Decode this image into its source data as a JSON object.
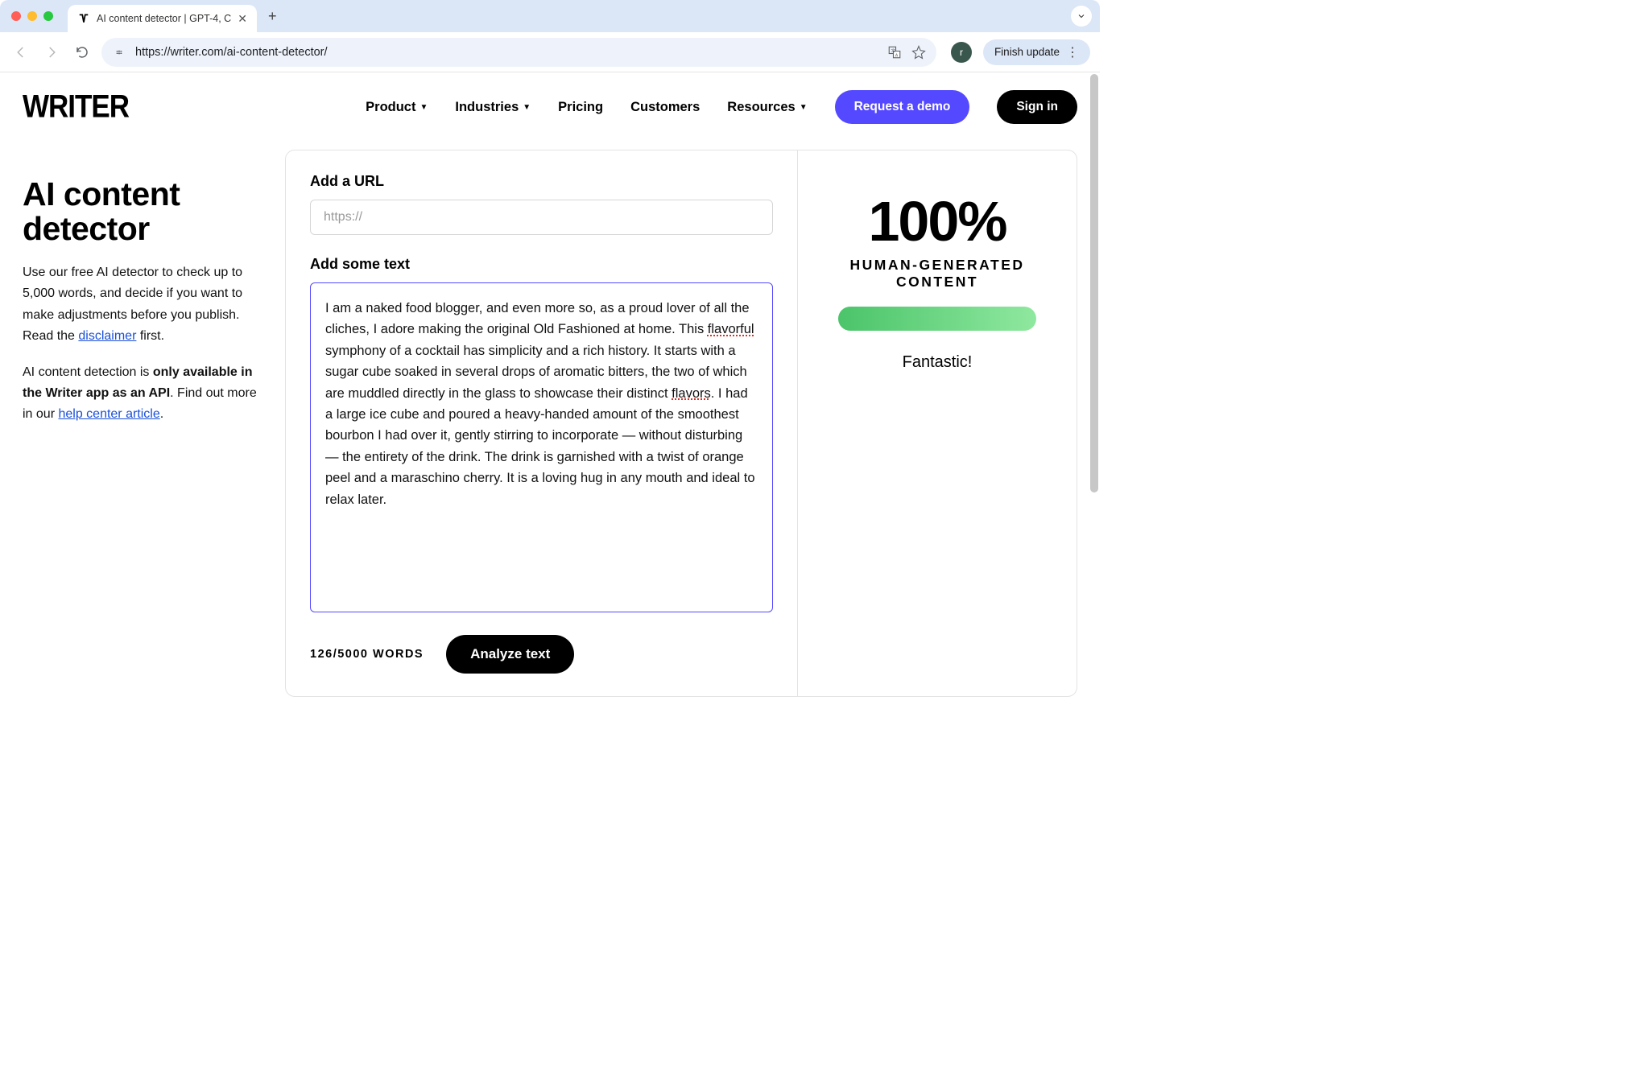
{
  "browser": {
    "tab_title": "AI content detector | GPT-4, C",
    "url": "https://writer.com/ai-content-detector/",
    "finish_update": "Finish update",
    "profile_letter": "r"
  },
  "header": {
    "logo": "WRITER",
    "nav": {
      "product": "Product",
      "industries": "Industries",
      "pricing": "Pricing",
      "customers": "Customers",
      "resources": "Resources"
    },
    "request_demo": "Request a demo",
    "sign_in": "Sign in"
  },
  "left": {
    "title": "AI content detector",
    "p1a": "Use our free AI detector to check up to 5,000 words, and decide if you want to make adjustments before you publish. Read the ",
    "disclaimer": "disclaimer",
    "p1b": " first.",
    "p2a": "AI content detection is ",
    "p2bold": "only available in the Writer app as an API",
    "p2b": ". Find out more in our ",
    "help_link": "help center article",
    "p2c": "."
  },
  "form": {
    "url_label": "Add a URL",
    "url_placeholder": "https://",
    "text_label": "Add some text",
    "text_value": "I am a naked food blogger, and even more so, as a proud lover of all the cliches, I adore making the original Old Fashioned at home. This flavorful symphony of a cocktail has simplicity and a rich history. It starts with a sugar cube soaked in several drops of aromatic bitters, the two of which are muddled directly in the glass to showcase their distinct flavors. I had a large ice cube and poured a heavy-handed amount of the smoothest bourbon I had over it, gently stirring to incorporate — without disturbing — the entirety of the drink. The drink is garnished with a twist of orange peel and a maraschino cherry. It is a loving hug in any mouth and ideal to relax later.",
    "word_count": "126/5000 WORDS",
    "analyze": "Analyze text"
  },
  "result": {
    "percent": "100%",
    "label": "HUMAN-GENERATED CONTENT",
    "message": "Fantastic!"
  }
}
